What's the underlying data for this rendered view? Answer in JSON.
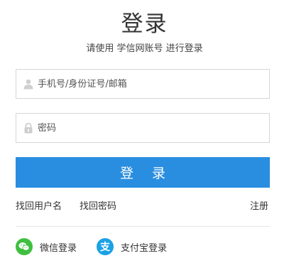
{
  "header": {
    "title": "登录",
    "subtitle": "请使用 学信网账号 进行登录"
  },
  "form": {
    "username_placeholder": "手机号/身份证号/邮箱",
    "username_value": "",
    "password_placeholder": "密码",
    "password_value": "",
    "submit_label": "登 录"
  },
  "links": {
    "forgot_username": "找回用户名",
    "forgot_password": "找回密码",
    "register": "注册"
  },
  "social": {
    "wechat_label": "微信登录",
    "alipay_label": "支付宝登录",
    "alipay_glyph": "支"
  },
  "colors": {
    "primary": "#2a8ee0",
    "wechat": "#3fbf3f",
    "alipay": "#1aa1e6"
  },
  "icons": [
    "user-icon",
    "lock-icon",
    "wechat-icon",
    "alipay-icon"
  ]
}
